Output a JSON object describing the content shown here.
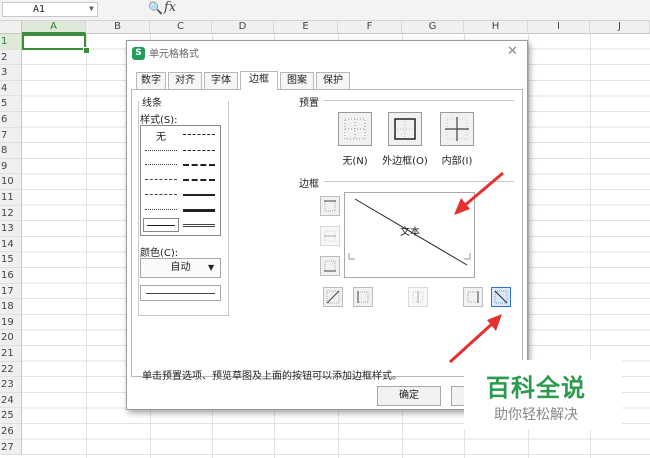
{
  "sheet": {
    "name_box": "A1",
    "columns": [
      "A",
      "B",
      "C",
      "D",
      "E",
      "F",
      "G",
      "H",
      "I",
      "J"
    ],
    "rows": [
      "1",
      "2",
      "3",
      "4",
      "5",
      "6",
      "7",
      "8",
      "9",
      "10",
      "11",
      "12",
      "13",
      "14",
      "15",
      "16",
      "17",
      "18",
      "19",
      "20",
      "21",
      "22",
      "23",
      "24",
      "25",
      "26",
      "27"
    ],
    "accent": "#3d8b3d"
  },
  "dialog": {
    "title": "单元格格式",
    "tabs": [
      "数字",
      "对齐",
      "字体",
      "边框",
      "图案",
      "保护"
    ],
    "active_tab": "边框",
    "line_group": "线条",
    "style_label": "样式(S):",
    "style_none": "无",
    "color_label": "颜色(C):",
    "color_value": "自动",
    "preset_group": "预置",
    "presets": [
      "无(N)",
      "外边框(O)",
      "内部(I)"
    ],
    "border_group": "边框",
    "preview_text": "文本",
    "hint": "单击预置选项、预览草图及上面的按钮可以添加边框样式。",
    "ok": "确定"
  },
  "watermark": {
    "main": "百科全说",
    "sub": "助你轻松解决",
    "color": "#2c9a4f"
  },
  "arrow_color": "#e53030"
}
